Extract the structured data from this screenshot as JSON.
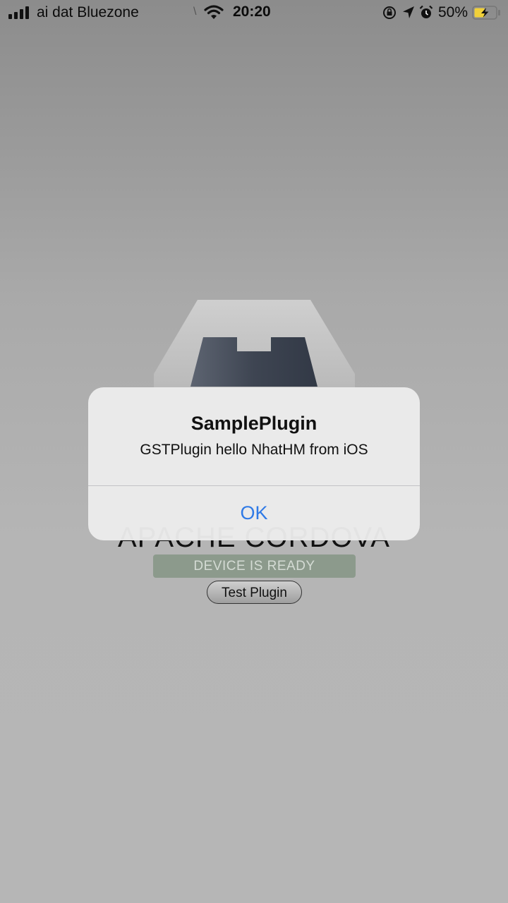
{
  "status_bar": {
    "carrier": "ai dat Bluezone",
    "time": "20:20",
    "battery_percent": "50%",
    "battery_level": 0.5,
    "battery_charging": true,
    "icons": [
      "signal-icon",
      "wifi-icon",
      "rotation-lock-icon",
      "location-icon",
      "alarm-icon",
      "battery-icon"
    ]
  },
  "app": {
    "title": "APACHE CORDOVA",
    "status_text": "DEVICE IS READY",
    "status_color": "#8c9a8c",
    "button_label": "Test Plugin"
  },
  "alert": {
    "title": "SamplePlugin",
    "message": "GSTPlugin hello NhatHM from iOS",
    "ok_label": "OK",
    "ok_color": "#2f7ae6"
  }
}
